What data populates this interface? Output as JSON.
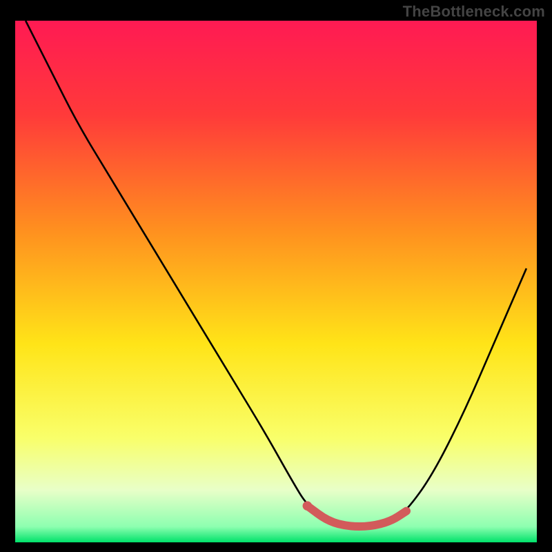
{
  "attribution": "TheBottleneck.com",
  "colors": {
    "frame": "#000000",
    "gradient_top": "#ff1a53",
    "gradient_upper_mid": "#ff8f1f",
    "gradient_mid": "#ffe418",
    "gradient_lower": "#f9ff6a",
    "gradient_pale": "#e8ffc8",
    "gradient_bottom": "#00e26a",
    "curve": "#000000",
    "highlight": "#d25b5b",
    "highlight_dot": "#d25b5b"
  },
  "chart_data": {
    "type": "line",
    "title": "",
    "xlabel": "",
    "ylabel": "",
    "x_range": [
      0,
      100
    ],
    "y_range": [
      0,
      100
    ],
    "note": "No axes or tick labels are rendered; values are normalized 0-100 estimates read from pixel positions. x is horizontal position left→right, y is curve height from bottom (0 = bottom edge, 100 = top edge).",
    "series": [
      {
        "name": "bottleneck-curve",
        "x": [
          2,
          7,
          12,
          18,
          24,
          30,
          36,
          42,
          48,
          53,
          56,
          60,
          64,
          68,
          72,
          75,
          80,
          86,
          92,
          98
        ],
        "y": [
          100,
          90,
          80,
          70,
          60,
          50,
          40,
          30,
          20,
          11,
          6,
          3,
          2,
          2,
          3,
          5,
          12,
          24,
          38,
          52
        ]
      }
    ],
    "highlight_segment": {
      "name": "optimal-range",
      "x": [
        56,
        60,
        64,
        68,
        72,
        75
      ],
      "y": [
        6,
        3,
        2,
        2,
        3,
        5
      ]
    },
    "highlight_dot": {
      "x": 56,
      "y": 6
    },
    "gradient_stops": [
      {
        "pos": 0.0,
        "color": "#ff1a53"
      },
      {
        "pos": 0.18,
        "color": "#ff3a3a"
      },
      {
        "pos": 0.4,
        "color": "#ff8f1f"
      },
      {
        "pos": 0.62,
        "color": "#ffe418"
      },
      {
        "pos": 0.8,
        "color": "#f9ff6a"
      },
      {
        "pos": 0.9,
        "color": "#e8ffc8"
      },
      {
        "pos": 0.97,
        "color": "#8dffb0"
      },
      {
        "pos": 1.0,
        "color": "#00e26a"
      }
    ]
  }
}
